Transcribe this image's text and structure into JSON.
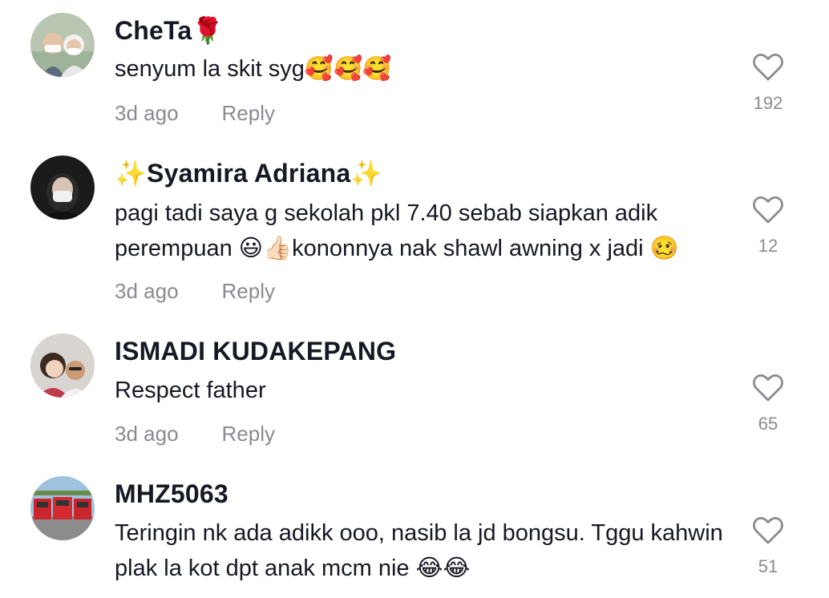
{
  "colors": {
    "primary_text": "#161823",
    "secondary_text": "#8a8b91",
    "icon": "#8a8b91"
  },
  "comments": [
    {
      "username": "CheTa🌹",
      "text": "senyum la skit syg🥰🥰🥰",
      "time": "3d ago",
      "reply": "Reply",
      "likes": "192"
    },
    {
      "username": "✨Syamira Adriana✨",
      "text": "pagi tadi saya g sekolah pkl 7.40 sebab siapkan adik perempuan 😃👍🏻kononnya nak shawl awning x jadi 🥴",
      "time": "3d ago",
      "reply": "Reply",
      "likes": "12"
    },
    {
      "username": "ISMADI KUDAKEPANG",
      "text": "Respect father",
      "time": "3d ago",
      "reply": "Reply",
      "likes": "65"
    },
    {
      "username": "MHZ5063",
      "text": "Teringin nk ada adikk ooo, nasib la jd bongsu. Tggu kahwin plak la kot dpt anak mcm nie 😂😂",
      "time": "",
      "reply": "",
      "likes": "51"
    }
  ]
}
